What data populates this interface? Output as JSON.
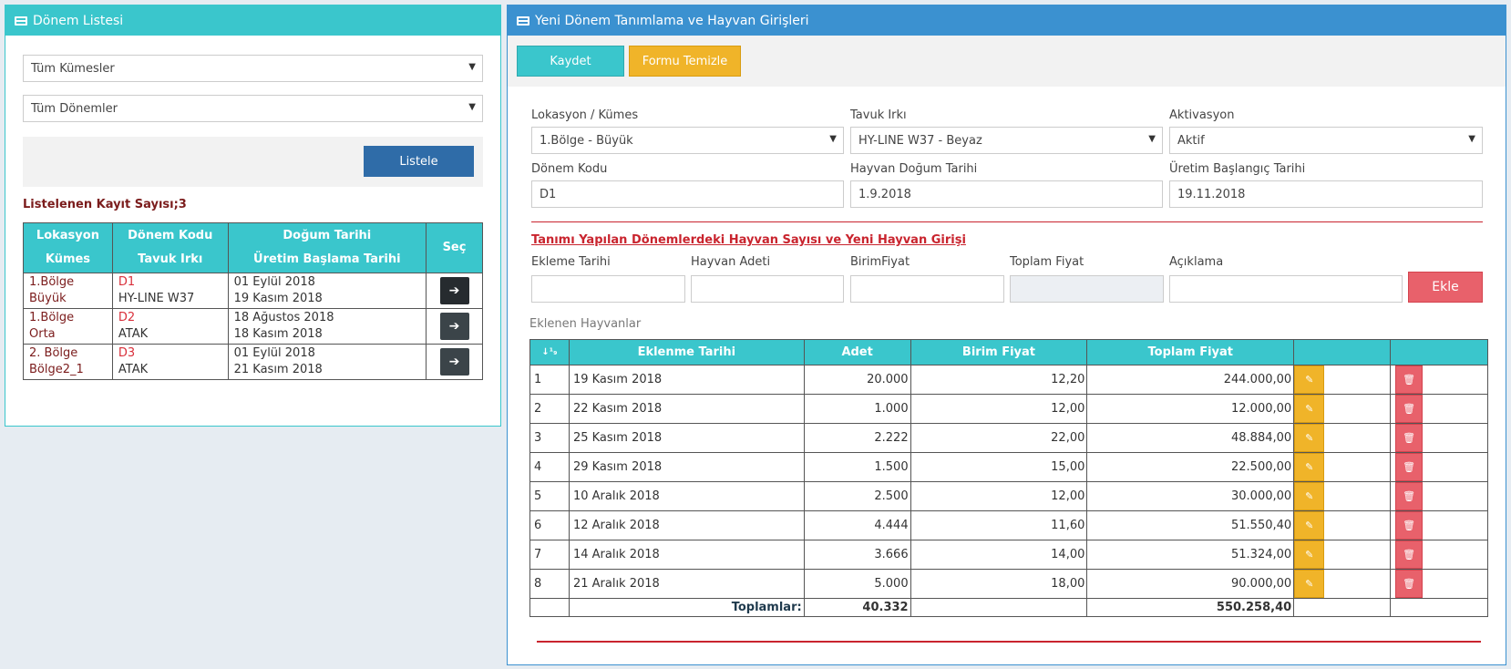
{
  "left": {
    "title": "Dönem Listesi",
    "select1": "Tüm Kümesler",
    "select2": "Tüm Dönemler",
    "list_button": "Listele",
    "record_count": "Listelenen Kayıt Sayısı;3",
    "headers": {
      "col1a": "Lokasyon",
      "col1b": "Kümes",
      "col2a": "Dönem Kodu",
      "col2b": "Tavuk Irkı",
      "col3a": "Doğum Tarihi",
      "col3b": "Üretim Başlama Tarihi",
      "col4": "Seç"
    },
    "rows": [
      {
        "loc1": "1.Bölge",
        "loc2": "Büyük",
        "code": "D1",
        "breed": "HY-LINE W37",
        "birth": "01 Eylül 2018",
        "start": "19 Kasım 2018"
      },
      {
        "loc1": "1.Bölge",
        "loc2": "Orta",
        "code": "D2",
        "breed": "ATAK",
        "birth": "18 Ağustos 2018",
        "start": "18 Kasım 2018"
      },
      {
        "loc1": "2. Bölge",
        "loc2": "Bölge2_1",
        "code": "D3",
        "breed": "ATAK",
        "birth": "01 Eylül 2018",
        "start": "21 Kasım 2018"
      }
    ]
  },
  "right": {
    "title": "Yeni Dönem Tanımlama ve Hayvan Girişleri",
    "save_button": "Kaydet",
    "clear_button": "Formu Temizle",
    "form": {
      "location_label": "Lokasyon / Kümes",
      "location_value": "1.Bölge - Büyük",
      "breed_label": "Tavuk Irkı",
      "breed_value": "HY-LINE W37 - Beyaz",
      "activation_label": "Aktivasyon",
      "activation_value": "Aktif",
      "code_label": "Dönem Kodu",
      "code_value": "D1",
      "birth_label": "Hayvan Doğum Tarihi",
      "birth_value": "1.9.2018",
      "start_label": "Üretim Başlangıç Tarihi",
      "start_value": "19.11.2018"
    },
    "section_title": "Tanımı Yapılan Dönemlerdeki Hayvan Sayısı ve Yeni Hayvan Girişi",
    "entry": {
      "date_label": "Ekleme Tarihi",
      "count_label": "Hayvan Adeti",
      "unit_label": "BirimFiyat",
      "total_label": "Toplam Fiyat",
      "desc_label": "Açıklama",
      "add_button": "Ekle"
    },
    "added_label": "Eklenen Hayvanlar",
    "table_headers": {
      "sort": "↓¹₉",
      "date": "Eklenme Tarihi",
      "count": "Adet",
      "unit": "Birim Fiyat",
      "total": "Toplam Fiyat"
    },
    "rows": [
      {
        "no": "1",
        "date": "19 Kasım 2018",
        "count": "20.000",
        "unit": "12,20",
        "total": "244.000,00"
      },
      {
        "no": "2",
        "date": "22 Kasım 2018",
        "count": "1.000",
        "unit": "12,00",
        "total": "12.000,00"
      },
      {
        "no": "3",
        "date": "25 Kasım 2018",
        "count": "2.222",
        "unit": "22,00",
        "total": "48.884,00"
      },
      {
        "no": "4",
        "date": "29 Kasım 2018",
        "count": "1.500",
        "unit": "15,00",
        "total": "22.500,00"
      },
      {
        "no": "5",
        "date": "10 Aralık 2018",
        "count": "2.500",
        "unit": "12,00",
        "total": "30.000,00"
      },
      {
        "no": "6",
        "date": "12 Aralık 2018",
        "count": "4.444",
        "unit": "11,60",
        "total": "51.550,40"
      },
      {
        "no": "7",
        "date": "14 Aralık 2018",
        "count": "3.666",
        "unit": "14,00",
        "total": "51.324,00"
      },
      {
        "no": "8",
        "date": "21 Aralık 2018",
        "count": "5.000",
        "unit": "18,00",
        "total": "90.000,00"
      }
    ],
    "totals_label": "Toplamlar:",
    "totals_count": "40.332",
    "totals_sum": "550.258,40"
  },
  "colors": {
    "teal": "#3ac6cc",
    "blue": "#3b91d0",
    "yellow": "#f0b429",
    "red": "#e8616b"
  }
}
